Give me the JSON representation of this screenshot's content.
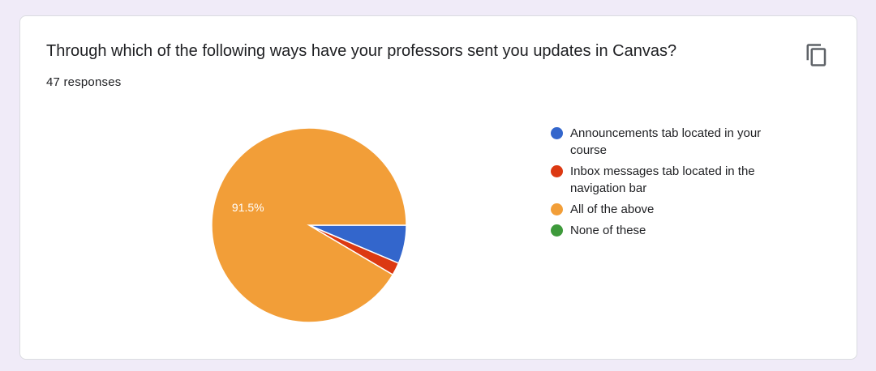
{
  "question": {
    "title": "Through which of the following ways have your professors sent you updates in Canvas?",
    "responses_label": "47 responses"
  },
  "icons": {
    "copy": "copy-icon"
  },
  "chart_data": {
    "type": "pie",
    "slices": [
      {
        "label": "Announcements tab located in your course",
        "value": 6.4,
        "color": "#3366cc"
      },
      {
        "label": "Inbox messages tab located in the navigation bar",
        "value": 2.1,
        "color": "#dc3912"
      },
      {
        "label": "All of the above",
        "value": 91.5,
        "color": "#f29e38",
        "data_label": "91.5%"
      },
      {
        "label": "None of these",
        "value": 0,
        "color": "#3e9a3b"
      }
    ],
    "legend_position": "right"
  }
}
